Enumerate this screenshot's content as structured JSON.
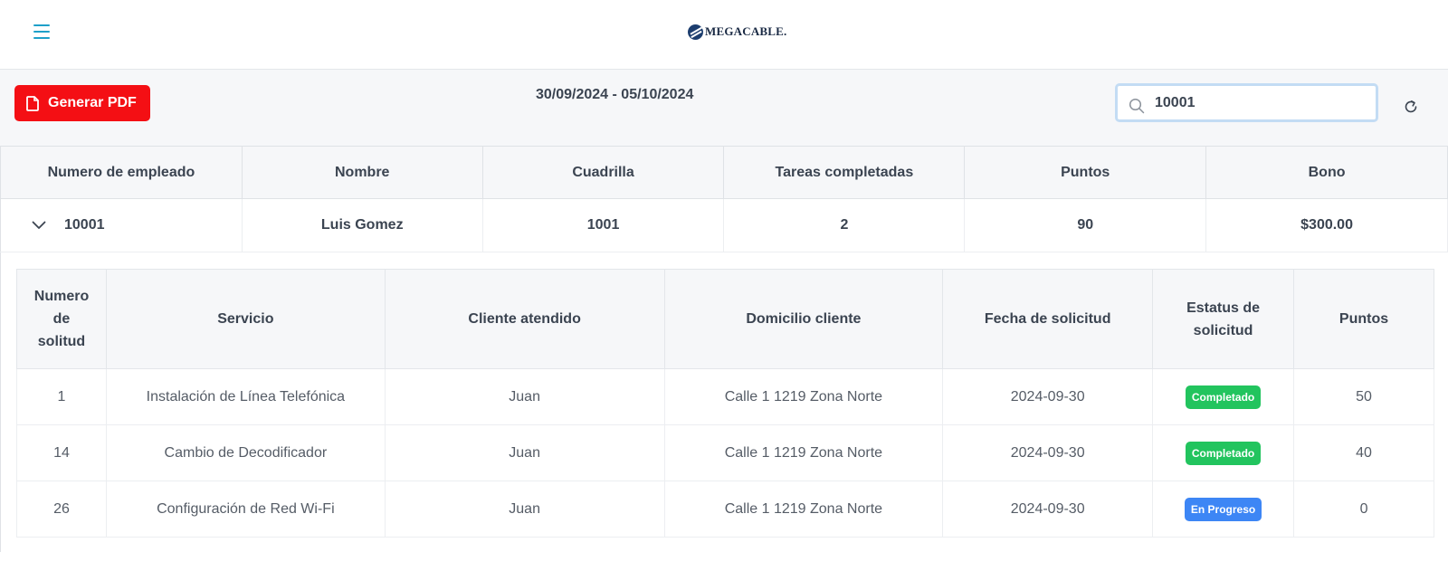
{
  "header": {
    "logo_text": "MEGACABLE."
  },
  "toolbar": {
    "pdf_label": "Generar PDF",
    "date_range": "30/09/2024 - 05/10/2024",
    "search_value": "10001"
  },
  "main_table": {
    "headers": [
      "Numero de empleado",
      "Nombre",
      "Cuadrilla",
      "Tareas completadas",
      "Puntos",
      "Bono"
    ],
    "row": {
      "employee_number": "10001",
      "name": "Luis Gomez",
      "crew": "1001",
      "tasks_completed": "2",
      "points": "90",
      "bonus": "$300.00"
    }
  },
  "sub_table": {
    "headers": [
      "Numero de solitud",
      "Servicio",
      "Cliente atendido",
      "Domicilio cliente",
      "Fecha de solicitud",
      "Estatus de solicitud",
      "Puntos"
    ],
    "rows": [
      {
        "id": "1",
        "service": "Instalación de Línea Telefónica",
        "client": "Juan",
        "address": "Calle 1 1219 Zona Norte",
        "date": "2024-09-30",
        "status": "Completado",
        "points": "50"
      },
      {
        "id": "14",
        "service": "Cambio de Decodificador",
        "client": "Juan",
        "address": "Calle 1 1219 Zona Norte",
        "date": "2024-09-30",
        "status": "Completado",
        "points": "40"
      },
      {
        "id": "26",
        "service": "Configuración de Red Wi-Fi",
        "client": "Juan",
        "address": "Calle 1 1219 Zona Norte",
        "date": "2024-09-30",
        "status": "En Progreso",
        "points": "0"
      }
    ]
  },
  "colors": {
    "completed": "#22c45e",
    "in_progress": "#3d86f5",
    "pdf_button": "#f40f14",
    "menu_icon": "#1ea0c9"
  }
}
